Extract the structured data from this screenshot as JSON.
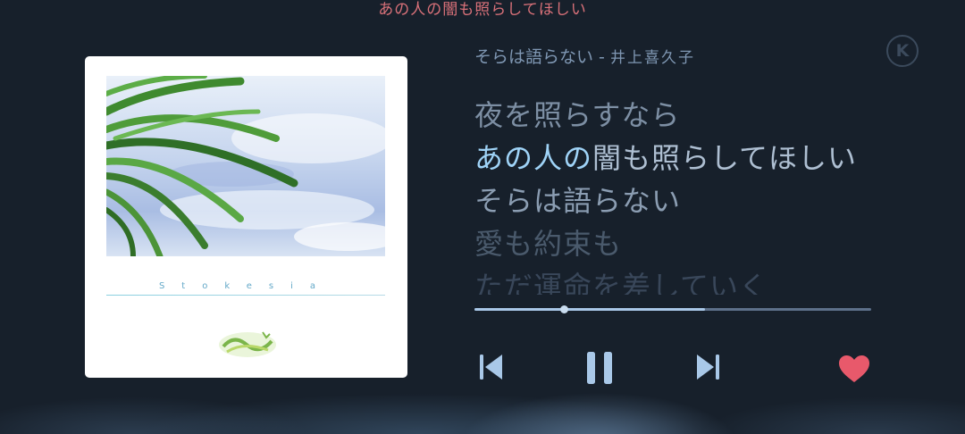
{
  "top_lyric": "あの人の闇も照らしてほしい",
  "album": {
    "brand_text": "Stokesia"
  },
  "song": {
    "title": "そらは語らない",
    "separator": " - ",
    "artist": "井上喜久子"
  },
  "lyrics": [
    "夜を照らすなら",
    "あの人の闇も照らしてほしい",
    "そらは語らない",
    "愛も約束も",
    "ただ運命を差していく"
  ],
  "current_line": {
    "highlighted": "あの人の",
    "rest": "闇も照らしてほしい"
  },
  "playback": {
    "buffered": 0.58,
    "progress": 0.225,
    "state": "playing"
  },
  "icons": {
    "badge": "K",
    "prev": "previous-icon",
    "pause": "pause-icon",
    "next": "next-icon",
    "like": "heart-icon"
  },
  "colors": {
    "background": "#17202b",
    "accent": "#a9c8e8",
    "heart": "#e8596b",
    "top_lyric": "#d97179"
  }
}
